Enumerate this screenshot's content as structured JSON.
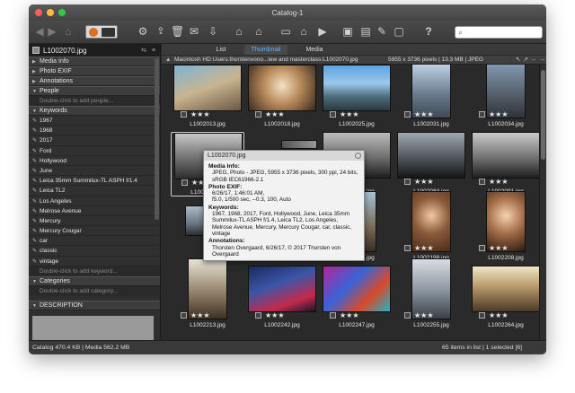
{
  "window": {
    "title": "Catalog-1"
  },
  "toolbar": {
    "search_placeholder": ""
  },
  "left": {
    "file_name": "L1002070.jpg",
    "sections": [
      "Media Info",
      "Photo EXIF",
      "Annotations",
      "People"
    ],
    "people_hint": "Double-click to add people...",
    "keywords_label": "Keywords",
    "keywords": [
      "1967",
      "1968",
      "2017",
      "Ford",
      "Hollywood",
      "June",
      "Leica 35mm Summilux-TL ASPH f/1.4",
      "Leica TL2",
      "Los Angeles",
      "Melrose Avenue",
      "Mercury",
      "Mercury Cougar",
      "car",
      "classic",
      "vintage"
    ],
    "keyword_hint": "Double-click to add keyword...",
    "categories_label": "Categories",
    "category_hint": "Double-click to add category...",
    "description_label": "DESCRIPTION"
  },
  "tabs": [
    "List",
    "Thumbnail",
    "Media"
  ],
  "pathbar": {
    "path": "Macintosh HD:Users:thorstenvono...iew and masterclass:L1002070.jpg",
    "info": "5955 x 3736 pixels  |  13.3 MB  |  JPEG"
  },
  "grid": {
    "rows": [
      [
        "L1002013.jpg",
        "L1002018.jpg",
        "L1002025.jpg",
        "L1002031.jpg",
        "L1002034.jpg"
      ],
      [
        "L1002070.jpg",
        "",
        "L1002080.jpg",
        "L1002084.jpg",
        "L1002091.jpg"
      ],
      [
        "",
        "",
        "L1002130.jpg",
        "L1002198.jpg",
        "L1002208.jpg"
      ],
      [
        "L1002213.jpg",
        "L1002242.jpg",
        "L1002247.jpg",
        "L1002255.jpg",
        "L1002264.jpg"
      ]
    ],
    "stars": "★★★"
  },
  "tooltip": {
    "title": "L1002070.jpg",
    "media_h": "Media Info:",
    "media_v": "JPEG, Photo - JPEG, 5955 x 3736 pixels, 300 ppi, 24 bits, sRGB IEC61966-2.1",
    "exif_h": "Photo EXIF:",
    "exif_v1": "6/26/17, 1:46:01 AM,",
    "exif_v2": "f5.0, 1/500 sec, --0.3, 100, Auto",
    "kw_h": "Keywords:",
    "kw_v": "1967, 1968, 2017, Ford, Hollywood, June, Leica 35mm Summilux-TL ASPH f/1.4, Leica TL2, Los Angeles, Melrose Avenue, Mercury, Mercury Cougar, car, classic, vintage",
    "ann_h": "Annotations:",
    "ann_v": "Thorsten Overgaard, 6/26/17, © 2017 Thorsten von Overgaard"
  },
  "status": {
    "left": "Catalog  470.4 KB  |  Media 562.2 MB",
    "right": "65 items in list  |  1 selected [6]"
  }
}
